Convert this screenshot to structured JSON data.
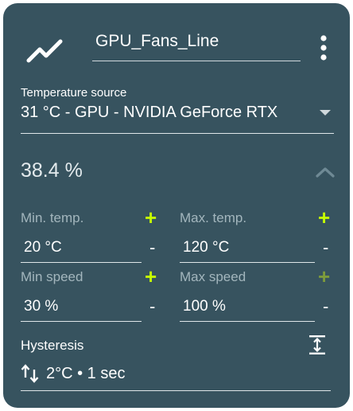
{
  "curve": {
    "name": "GPU_Fans_Line"
  },
  "temperature_source": {
    "label": "Temperature source",
    "value": "31 °C - GPU - NVIDIA GeForce RTX"
  },
  "speed_readout": "38.4 %",
  "min_temp": {
    "label": "Min. temp.",
    "value": "20 °C",
    "plus": "+",
    "minus": "-"
  },
  "max_temp": {
    "label": "Max. temp.",
    "value": "120 °C",
    "plus": "+",
    "minus": "-"
  },
  "min_speed": {
    "label": "Min speed",
    "value": "30 %",
    "plus": "+",
    "minus": "-"
  },
  "max_speed": {
    "label": "Max speed",
    "value": "100 %",
    "plus": "+",
    "minus": "-"
  },
  "hysteresis": {
    "label": "Hysteresis",
    "value": "2°C • 1 sec"
  },
  "colors": {
    "card_bg": "#37535f",
    "accent_plus": "#c6ff00",
    "accent_plus_dim": "#7d9b3c",
    "label": "#a3b6bd"
  },
  "icons": {
    "curve": "line-chart-icon",
    "menu": "more-vert-icon",
    "dropdown": "arrow-drop-down-icon",
    "collapse": "chevron-up-icon",
    "hysteresis_edit": "vertical-align-center-icon",
    "hysteresis_value": "swap-vert-icon"
  }
}
